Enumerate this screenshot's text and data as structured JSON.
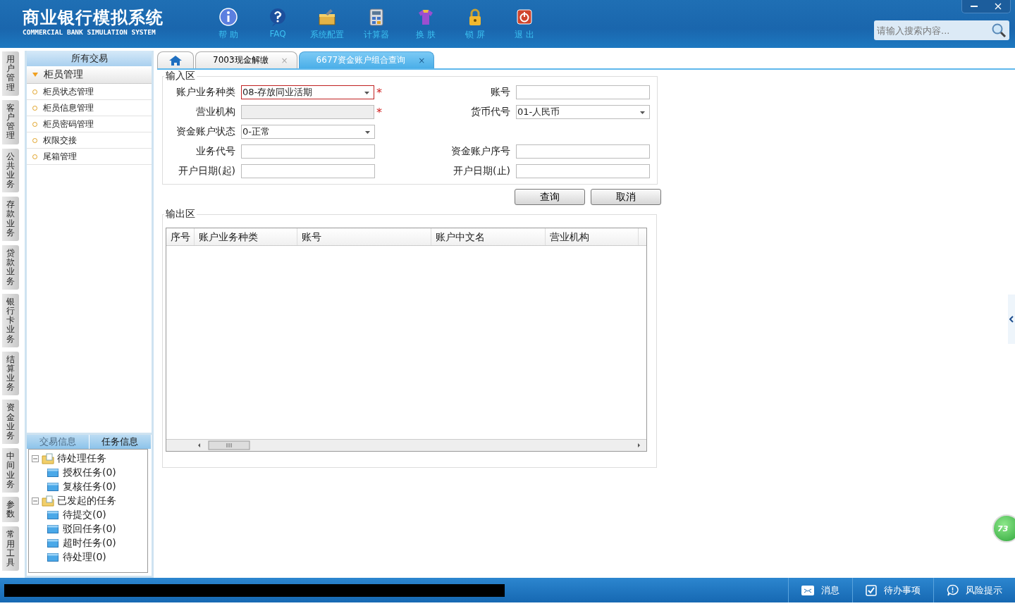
{
  "header": {
    "title": "商业银行模拟系统",
    "subtitle": "COMMERCIAL BANK SIMULATION SYSTEM",
    "tools": [
      {
        "label": "帮 助"
      },
      {
        "label": "FAQ"
      },
      {
        "label": "系统配置"
      },
      {
        "label": "计算器"
      },
      {
        "label": "换 肤"
      },
      {
        "label": "锁 屏"
      },
      {
        "label": "退 出"
      }
    ],
    "search": {
      "placeholder": "请输入搜索内容..."
    }
  },
  "side_tabs": [
    "用户管理",
    "客户管理",
    "公共业务",
    "存款业务",
    "贷款业务",
    "银行卡业务",
    "结算业务",
    "资金业务",
    "中间业务",
    "参数",
    "常用工具"
  ],
  "sidebar": {
    "title": "所有交易",
    "group": {
      "label": "柜员管理",
      "expanded": true,
      "items": [
        "柜员状态管理",
        "柜员信息管理",
        "柜员密码管理",
        "权限交接",
        "尾箱管理"
      ]
    },
    "panel_tabs": [
      {
        "label": "交易信息",
        "selected": false
      },
      {
        "label": "任务信息",
        "selected": true
      }
    ],
    "tree": [
      {
        "label": "待处理任务",
        "expanded": true,
        "children": [
          {
            "label": "授权任务(0)"
          },
          {
            "label": "复核任务(0)"
          }
        ]
      },
      {
        "label": "已发起的任务",
        "expanded": true,
        "children": [
          {
            "label": "待提交(0)"
          },
          {
            "label": "驳回任务(0)"
          },
          {
            "label": "超时任务(0)"
          },
          {
            "label": "待处理(0)"
          }
        ]
      }
    ]
  },
  "tabs": [
    {
      "kind": "home",
      "selected": false
    },
    {
      "kind": "page",
      "label": "7003现金解缴",
      "close": "×",
      "selected": false
    },
    {
      "kind": "page",
      "label": "6677资金账户组合查询",
      "close": "×",
      "selected": true
    }
  ],
  "input_area": {
    "title": "输入区",
    "rows": [
      [
        {
          "label": "账户业务种类",
          "kind": "select",
          "value": "08-存放同业活期",
          "required": true,
          "error": true,
          "disabled": false
        },
        {
          "label": "账号",
          "kind": "text",
          "required": false,
          "error": false,
          "disabled": false
        }
      ],
      [
        {
          "label": "营业机构",
          "kind": "text",
          "required": true,
          "error": false,
          "disabled": true
        },
        {
          "label": "货币代号",
          "kind": "select",
          "value": "01-人民币",
          "required": false,
          "error": false,
          "disabled": false
        }
      ],
      [
        {
          "label": "资金账户状态",
          "kind": "select",
          "value": "0-正常",
          "required": false,
          "error": false,
          "disabled": false
        }
      ],
      [
        {
          "label": "业务代号",
          "kind": "text",
          "required": false,
          "error": false,
          "disabled": false
        },
        {
          "label": "资金账户序号",
          "kind": "text",
          "required": false,
          "error": false,
          "disabled": false
        }
      ],
      [
        {
          "label": "开户日期(起)",
          "kind": "text",
          "required": false,
          "error": false,
          "disabled": false
        },
        {
          "label": "开户日期(止)",
          "kind": "text",
          "required": false,
          "error": false,
          "disabled": false
        }
      ]
    ],
    "required_mark": "*",
    "buttons": [
      "查询",
      "取消"
    ]
  },
  "output_area": {
    "title": "输出区",
    "columns": [
      "序号",
      "账户业务种类",
      "账号",
      "账户中文名",
      "营业机构"
    ]
  },
  "float_badge": "73",
  "status_bar": [
    {
      "label": "消息"
    },
    {
      "label": "待办事项"
    },
    {
      "label": "风险提示"
    }
  ]
}
